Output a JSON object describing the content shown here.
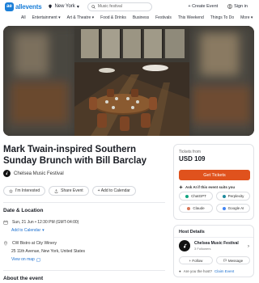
{
  "header": {
    "logo_text": "allevents",
    "logo_mark": "ae",
    "city": "New York",
    "search_placeholder": "Music festival",
    "create_label": "+ Create Event",
    "signin_label": "Sign in"
  },
  "categories": [
    "All",
    "Entertainment ▾",
    "Art & Theatre ▾",
    "Food & Drinks",
    "Business",
    "Festivals",
    "This Weekend",
    "Things To Do",
    "More ▾"
  ],
  "event": {
    "title": "Mark Twain-inspired Southern Sunday Brunch with Bill Barclay",
    "organizer": "Chelsea Music Festival",
    "buttons": {
      "interested": "I'm Interested",
      "share": "Share Event",
      "calendar": "+ Add to Calendar"
    }
  },
  "date_location": {
    "heading": "Date & Location",
    "datetime": "Sun, 21 Jun • 12:30 PM (GMT-04:00)",
    "add_calendar": "Add to Calendar",
    "venue": "CW Bistro at City Winery",
    "address": "25 11th Avenue, New York, United States",
    "map_link": "View on map"
  },
  "about_heading": "About the event",
  "tickets": {
    "label": "Tickets from",
    "price": "USD 109",
    "button": "Get Tickets",
    "ai_prompt": "Ask AI if this event suits you",
    "ai_options": [
      {
        "label": "ChatGPT",
        "color": "#10a37f"
      },
      {
        "label": "Perplexity",
        "color": "#1f8a9e"
      },
      {
        "label": "Claude",
        "color": "#d97757"
      },
      {
        "label": "Google AI",
        "color": "#4285f4"
      }
    ]
  },
  "host": {
    "heading": "Host Details",
    "name": "Chelsea Music Festival",
    "followers": "3 Followers",
    "follow_label": "+ Follow",
    "message_label": "Message",
    "claim_prefix": "Are you the host?",
    "claim_link": "Claim Event"
  },
  "colors": {
    "brand": "#1b7fd8",
    "accent": "#e0521d",
    "link": "#1b6fd0"
  }
}
